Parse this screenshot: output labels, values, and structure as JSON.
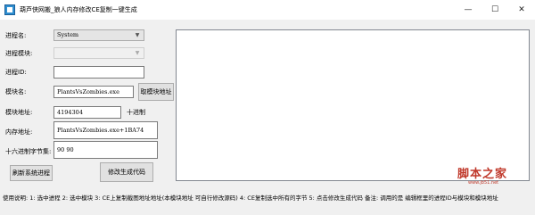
{
  "window": {
    "title": "葫芦侠网搬_狼人内存修改CE复制一键生成",
    "minimize": "—",
    "maximize": "☐",
    "close": "✕"
  },
  "form": {
    "process_label": "进程名:",
    "process_value": "System",
    "module_label": "进程模块:",
    "module_value": "",
    "pid_label": "进程ID:",
    "pid_value": "",
    "module_name_label": "模块名:",
    "module_name_value": "PlantsVsZombies.exe",
    "get_address_button": "取模块地址",
    "module_address_label": "模块地址:",
    "module_address_value": "4194304",
    "decimal_label": "十进制",
    "memory_address_label": "内存地址:",
    "memory_address_value": "PlantsVsZombies.exe+1BA74",
    "hex_bytes_label": "十六进制字节集:",
    "hex_bytes_value": "90 90",
    "refresh_button": "刷新系统进程",
    "generate_button": "修改生成代码"
  },
  "output": {
    "text": ""
  },
  "footer": {
    "usage": "使用说明:  1: 选中进程   2: 选中模块   3: CE上复制截图地址地址(本模块地址 可自行修改源码)   4: CE复制选中所有的字节   5: 点击修改生成代码        备注: 调用的是 编辑框里的进程ID与模块和模块地址"
  },
  "watermark": {
    "text": "脚本之家",
    "url": "www.jb51.net"
  }
}
